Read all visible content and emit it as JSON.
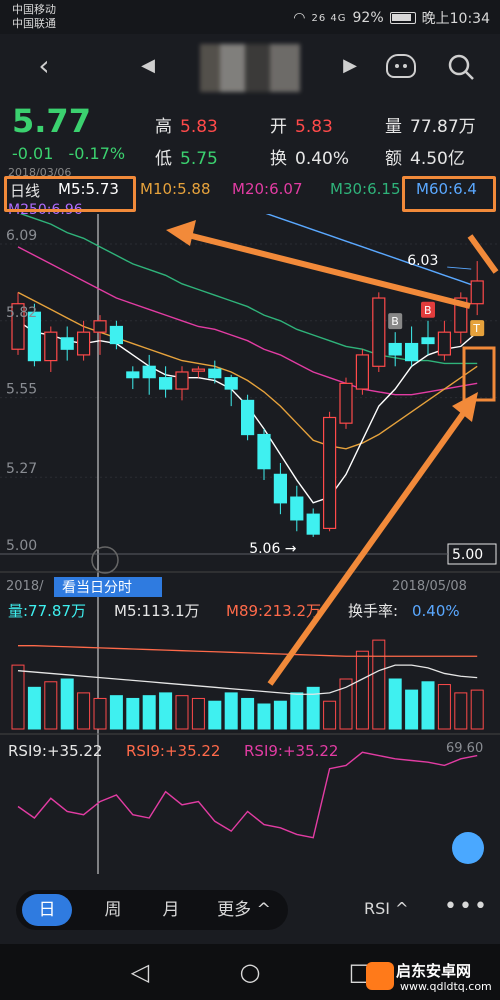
{
  "status": {
    "carrier1": "中国移动",
    "carrier2": "中国联通",
    "signal": "26 4G",
    "battery": "92%",
    "time": "晚上10:34"
  },
  "nav": {
    "back": "‹",
    "prev": "◀",
    "next": "▶",
    "search_icon": "search-icon"
  },
  "quote": {
    "price": "5.77",
    "change": "-0.01",
    "change_pct": "-0.17%",
    "high_label": "高",
    "high": "5.83",
    "low_label": "低",
    "low": "5.75",
    "open_label": "开",
    "open": "5.83",
    "turnover_label": "换",
    "turnover": "0.40%",
    "volume_label": "量",
    "volume": "77.87万",
    "amount_label": "额",
    "amount": "4.50亿"
  },
  "ma": {
    "period": "日线",
    "m5": "M5:5.73",
    "m10": "M10:5.88",
    "m20": "M20:6.07",
    "m30": "M30:6.15",
    "m60": "M60:6.4",
    "m250": "M250:6.96",
    "date_top": "2018/03/06"
  },
  "chart_data": {
    "type": "candlestick",
    "y_ticks": [
      "6.09",
      "5.82",
      "5.55",
      "5.27",
      "5.00"
    ],
    "current_price_tag": "5.00",
    "high_marker": "6.03",
    "low_marker": "5.06",
    "date_left": "2018/",
    "date_right": "2018/05/08",
    "intraday_button": "看当日分时",
    "markers": [
      "B",
      "B",
      "T"
    ],
    "ylim": [
      5.0,
      6.09
    ],
    "candles": [
      {
        "o": 5.72,
        "c": 5.88,
        "h": 5.92,
        "l": 5.7
      },
      {
        "o": 5.85,
        "c": 5.68,
        "h": 5.88,
        "l": 5.66
      },
      {
        "o": 5.68,
        "c": 5.78,
        "h": 5.8,
        "l": 5.64
      },
      {
        "o": 5.76,
        "c": 5.72,
        "h": 5.8,
        "l": 5.68
      },
      {
        "o": 5.7,
        "c": 5.78,
        "h": 5.82,
        "l": 5.68
      },
      {
        "o": 5.78,
        "c": 5.82,
        "h": 5.84,
        "l": 5.7
      },
      {
        "o": 5.8,
        "c": 5.74,
        "h": 5.82,
        "l": 5.72
      },
      {
        "o": 5.64,
        "c": 5.62,
        "h": 5.66,
        "l": 5.58
      },
      {
        "o": 5.66,
        "c": 5.62,
        "h": 5.7,
        "l": 5.56
      },
      {
        "o": 5.62,
        "c": 5.58,
        "h": 5.66,
        "l": 5.55
      },
      {
        "o": 5.58,
        "c": 5.64,
        "h": 5.66,
        "l": 5.54
      },
      {
        "o": 5.65,
        "c": 5.65,
        "h": 5.66,
        "l": 5.62
      },
      {
        "o": 5.65,
        "c": 5.62,
        "h": 5.68,
        "l": 5.6
      },
      {
        "o": 5.62,
        "c": 5.58,
        "h": 5.63,
        "l": 5.52
      },
      {
        "o": 5.54,
        "c": 5.42,
        "h": 5.56,
        "l": 5.4
      },
      {
        "o": 5.42,
        "c": 5.3,
        "h": 5.44,
        "l": 5.26
      },
      {
        "o": 5.28,
        "c": 5.18,
        "h": 5.32,
        "l": 5.14
      },
      {
        "o": 5.2,
        "c": 5.12,
        "h": 5.24,
        "l": 5.08
      },
      {
        "o": 5.14,
        "c": 5.07,
        "h": 5.16,
        "l": 5.06
      },
      {
        "o": 5.09,
        "c": 5.48,
        "h": 5.5,
        "l": 5.08
      },
      {
        "o": 5.46,
        "c": 5.6,
        "h": 5.62,
        "l": 5.44
      },
      {
        "o": 5.58,
        "c": 5.7,
        "h": 5.72,
        "l": 5.56
      },
      {
        "o": 5.66,
        "c": 5.9,
        "h": 5.92,
        "l": 5.64
      },
      {
        "o": 5.74,
        "c": 5.7,
        "h": 5.78,
        "l": 5.66
      },
      {
        "o": 5.74,
        "c": 5.68,
        "h": 5.8,
        "l": 5.66
      },
      {
        "o": 5.76,
        "c": 5.74,
        "h": 5.82,
        "l": 5.7
      },
      {
        "o": 5.7,
        "c": 5.78,
        "h": 5.82,
        "l": 5.68
      },
      {
        "o": 5.78,
        "c": 5.9,
        "h": 5.92,
        "l": 5.74
      },
      {
        "o": 5.88,
        "c": 5.96,
        "h": 6.03,
        "l": 5.84
      }
    ],
    "ma5": [
      5.82,
      5.78,
      5.77,
      5.75,
      5.74,
      5.75,
      5.74,
      5.7,
      5.66,
      5.63,
      5.62,
      5.62,
      5.61,
      5.58,
      5.52,
      5.44,
      5.35,
      5.26,
      5.18,
      5.2,
      5.28,
      5.4,
      5.52,
      5.58,
      5.66,
      5.7,
      5.72,
      5.73,
      5.78
    ],
    "ma10": [
      5.92,
      5.89,
      5.86,
      5.83,
      5.8,
      5.78,
      5.76,
      5.74,
      5.72,
      5.7,
      5.68,
      5.67,
      5.66,
      5.64,
      5.61,
      5.57,
      5.52,
      5.46,
      5.4,
      5.38,
      5.37,
      5.39,
      5.42,
      5.46,
      5.5,
      5.54,
      5.58,
      5.62,
      5.66
    ],
    "ma20": [
      6.08,
      6.05,
      6.02,
      5.99,
      5.96,
      5.93,
      5.9,
      5.88,
      5.86,
      5.84,
      5.82,
      5.8,
      5.79,
      5.77,
      5.75,
      5.72,
      5.7,
      5.67,
      5.64,
      5.62,
      5.6,
      5.58,
      5.57,
      5.56,
      5.56,
      5.57,
      5.58,
      5.59,
      5.6
    ],
    "ma30": [
      6.2,
      6.18,
      6.16,
      6.13,
      6.11,
      6.08,
      6.05,
      6.02,
      6.0,
      5.98,
      5.95,
      5.93,
      5.91,
      5.89,
      5.87,
      5.84,
      5.82,
      5.79,
      5.77,
      5.75,
      5.73,
      5.72,
      5.7,
      5.69,
      5.68,
      5.68,
      5.67,
      5.67,
      5.67
    ],
    "ma60": [
      6.4,
      6.39,
      6.38,
      6.37,
      6.36,
      6.35,
      6.34,
      6.32,
      6.31,
      6.3,
      6.29,
      6.27,
      6.26,
      6.24,
      6.22,
      6.2,
      6.18,
      6.16,
      6.14,
      6.12,
      6.1,
      6.08,
      6.06,
      6.04,
      6.02,
      6.0,
      5.98,
      5.96,
      5.94
    ],
    "volume": {
      "label": "量:77.87万",
      "m5": "M5:113.1万",
      "m89": "M89:213.2万",
      "turnover_label": "换手率:",
      "turnover": "0.40%",
      "values": [
        230,
        150,
        170,
        180,
        130,
        110,
        120,
        110,
        120,
        130,
        120,
        110,
        100,
        130,
        110,
        90,
        100,
        130,
        150,
        100,
        180,
        280,
        320,
        180,
        140,
        170,
        160,
        130,
        140
      ],
      "avg": [
        210,
        205,
        200,
        195,
        190,
        185,
        180,
        175,
        170,
        165,
        160,
        155,
        150,
        145,
        140,
        135,
        130,
        125,
        125,
        130,
        150,
        180,
        210,
        230,
        230,
        220,
        200,
        190,
        185
      ],
      "avg_long": [
        300,
        300,
        298,
        296,
        294,
        292,
        290,
        288,
        286,
        284,
        282,
        280,
        278,
        276,
        274,
        272,
        270,
        268,
        266,
        264,
        262,
        262,
        262,
        262,
        262,
        262,
        262,
        262,
        262
      ]
    },
    "rsi": {
      "label1": "RSI9:+35.22",
      "label2": "RSI9:+35.22",
      "label3": "RSI9:+35.22",
      "max_label": "69.60",
      "values": [
        35,
        28,
        40,
        32,
        30,
        38,
        42,
        30,
        28,
        44,
        36,
        38,
        26,
        20,
        32,
        24,
        22,
        18,
        16,
        58,
        60,
        68,
        66,
        64,
        63,
        62,
        60,
        64,
        66
      ]
    }
  },
  "bottom": {
    "day": "日",
    "week": "周",
    "month": "月",
    "more": "更多 ^",
    "indicator": "RSI ^",
    "dots": "•••"
  },
  "watermark": {
    "name": "启东安卓网",
    "url": "www.qdldtq.com"
  },
  "colors": {
    "up": "#ff4a4a",
    "down": "#3ff0f0",
    "ma5": "#ffffff",
    "ma10": "#e6a23c",
    "ma20": "#e23ca3",
    "ma30": "#2fb37a",
    "ma60": "#5aa8ff",
    "ma250": "#b06cff",
    "annotation": "#f28a3a"
  }
}
